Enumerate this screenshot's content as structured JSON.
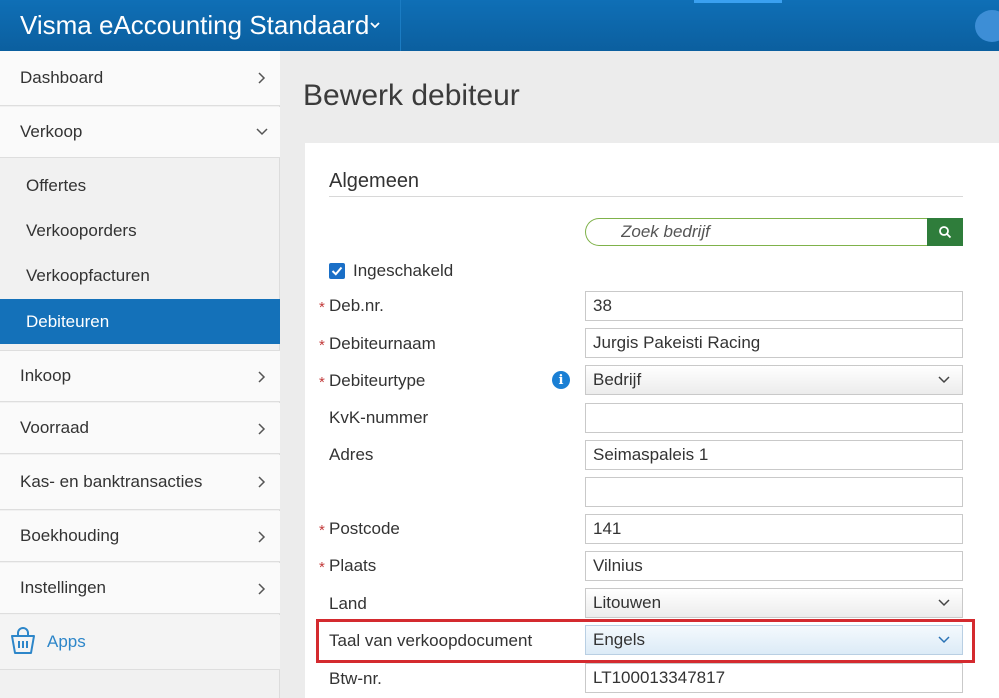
{
  "app": {
    "title": "Visma eAccounting Standaard"
  },
  "sidebar": {
    "items": [
      {
        "label": "Dashboard"
      },
      {
        "label": "Verkoop"
      },
      {
        "label": "Offertes"
      },
      {
        "label": "Verkooporders"
      },
      {
        "label": "Verkoopfacturen"
      },
      {
        "label": "Debiteuren"
      },
      {
        "label": "Inkoop"
      },
      {
        "label": "Voorraad"
      },
      {
        "label": "Kas- en banktransacties"
      },
      {
        "label": "Boekhouding"
      },
      {
        "label": "Instellingen"
      }
    ],
    "apps_label": "Apps"
  },
  "page": {
    "title": "Bewerk debiteur",
    "section_title": "Algemeen"
  },
  "search": {
    "placeholder": "Zoek bedrijf"
  },
  "form": {
    "enabled_label": "Ingeschakeld",
    "enabled": true,
    "required_marker": "*",
    "fields": {
      "deb_nr": {
        "label": "Deb.nr.",
        "value": "38"
      },
      "debiteurnaam": {
        "label": "Debiteurnaam",
        "value": "Jurgis Pakeisti Racing"
      },
      "debiteurtype": {
        "label": "Debiteurtype",
        "value": "Bedrijf"
      },
      "kvk": {
        "label": "KvK-nummer",
        "value": ""
      },
      "adres": {
        "label": "Adres",
        "value": "Seimaspaleis 1"
      },
      "adres2": {
        "value": ""
      },
      "postcode": {
        "label": "Postcode",
        "value": "141"
      },
      "plaats": {
        "label": "Plaats",
        "value": "Vilnius"
      },
      "land": {
        "label": "Land",
        "value": "Litouwen"
      },
      "taal": {
        "label": "Taal van verkoopdocument",
        "value": "Engels"
      },
      "btw": {
        "label": "Btw-nr.",
        "value": "LT100013347817"
      }
    }
  },
  "colors": {
    "topbar": "#0b5f9f",
    "active_nav": "#1471b9",
    "highlight": "#d42a2f",
    "search_button": "#2f7d3b",
    "link": "#2d86c9"
  }
}
